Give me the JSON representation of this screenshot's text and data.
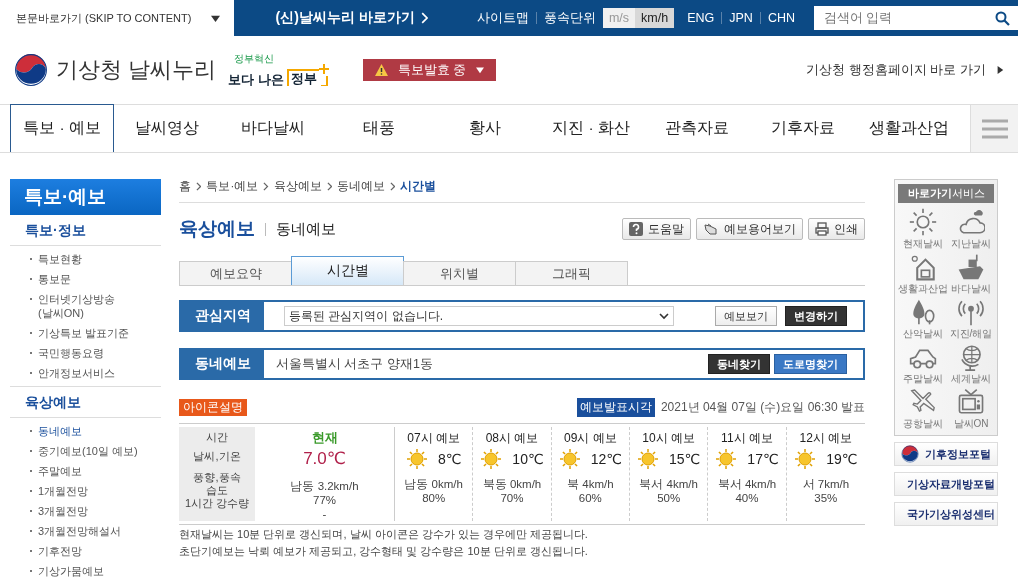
{
  "top_bar": {
    "skip_link": "본문바로가기 (SKIP TO CONTENT)",
    "new_site_link": "(신)날씨누리 바로가기",
    "sitemap": "사이트맵",
    "wind_unit": {
      "label": "풍속단위",
      "options": [
        {
          "label": "m/s",
          "selected": false
        },
        {
          "label": "km/h",
          "selected": true
        }
      ]
    },
    "languages": [
      "ENG",
      "JPN",
      "CHN"
    ],
    "search": {
      "placeholder": "검색어 입력"
    }
  },
  "header": {
    "logo_text": "기상청 날씨누리",
    "gov_badge": {
      "small": "정부혁신",
      "main_left": "보다 나은",
      "main_right": "정부"
    },
    "alert_button": "특보발효 중",
    "admin_link": "기상청 행정홈페이지 바로 가기"
  },
  "nav": [
    {
      "label": "특보 · 예보",
      "selected": true
    },
    {
      "label": "날씨영상",
      "selected": false
    },
    {
      "label": "바다날씨",
      "selected": false
    },
    {
      "label": "태풍",
      "selected": false
    },
    {
      "label": "황사",
      "selected": false
    },
    {
      "label": "지진 · 화산",
      "selected": false
    },
    {
      "label": "관측자료",
      "selected": false
    },
    {
      "label": "기후자료",
      "selected": false
    },
    {
      "label": "생활과산업",
      "selected": false
    }
  ],
  "sidebar": {
    "title": "특보·예보",
    "sections": [
      {
        "title": "특보·정보",
        "items": [
          {
            "label": "특보현황",
            "selected": false
          },
          {
            "label": "통보문",
            "selected": false
          },
          {
            "label": "인터넷기상방송 (날씨ON)",
            "selected": false
          },
          {
            "label": "기상특보 발표기준",
            "selected": false
          },
          {
            "label": "국민행동요령",
            "selected": false
          },
          {
            "label": "안개정보서비스",
            "selected": false
          }
        ]
      },
      {
        "title": "육상예보",
        "items": [
          {
            "label": "동네예보",
            "selected": true
          },
          {
            "label": "중기예보(10일 예보)",
            "selected": false
          },
          {
            "label": "주말예보",
            "selected": false
          },
          {
            "label": "1개월전망",
            "selected": false
          },
          {
            "label": "3개월전망",
            "selected": false
          },
          {
            "label": "3개월전망해설서",
            "selected": false
          },
          {
            "label": "기후전망",
            "selected": false
          },
          {
            "label": "기상가뭄예보",
            "selected": false
          }
        ]
      }
    ]
  },
  "breadcrumb": [
    {
      "label": "홈",
      "selected": false
    },
    {
      "label": "특보·예보",
      "selected": false
    },
    {
      "label": "육상예보",
      "selected": false
    },
    {
      "label": "동네예보",
      "selected": false
    },
    {
      "label": "시간별",
      "selected": true
    }
  ],
  "page_title": "육상예보",
  "page_subtitle": "동네예보",
  "tools": [
    "도움말",
    "예보용어보기",
    "인쇄"
  ],
  "tabs": [
    {
      "label": "예보요약",
      "selected": false
    },
    {
      "label": "시간별",
      "selected": true
    },
    {
      "label": "위치별",
      "selected": false
    },
    {
      "label": "그래픽",
      "selected": false
    }
  ],
  "interest_area": {
    "label": "관심지역",
    "select_value": "등록된 관심지역이 없습니다.",
    "buttons": [
      {
        "label": "예보보기",
        "kind": "light"
      },
      {
        "label": "변경하기",
        "kind": "dark"
      }
    ]
  },
  "local_forecast": {
    "label": "동네예보",
    "location": "서울특별시 서초구 양재1동",
    "buttons": [
      {
        "label": "동네찾기",
        "kind": "dark"
      },
      {
        "label": "도로명찾기",
        "kind": "blue"
      }
    ]
  },
  "icon_legend_button": "아이콘설명",
  "issued": {
    "label": "예보발표시각",
    "value": "2021년 04월 07일 (수)요일 06:30 발표"
  },
  "forecast_table": {
    "row_labels": [
      "시간",
      "날씨,기온",
      "풍향,풍속",
      "습도",
      "1시간 강수량"
    ],
    "current": {
      "label": "현재",
      "temp": "7.0℃",
      "wind": "남동 3.2km/h",
      "humidity": "77%",
      "rain": "-"
    },
    "hours": [
      {
        "label": "07시 예보",
        "temp": "8℃",
        "wind": "남동 0km/h",
        "humidity": "80%"
      },
      {
        "label": "08시 예보",
        "temp": "10℃",
        "wind": "북동 0km/h",
        "humidity": "70%"
      },
      {
        "label": "09시 예보",
        "temp": "12℃",
        "wind": "북 4km/h",
        "humidity": "60%"
      },
      {
        "label": "10시 예보",
        "temp": "15℃",
        "wind": "북서 4km/h",
        "humidity": "50%"
      },
      {
        "label": "11시 예보",
        "temp": "17℃",
        "wind": "북서 4km/h",
        "humidity": "40%"
      },
      {
        "label": "12시 예보",
        "temp": "19℃",
        "wind": "서 7km/h",
        "humidity": "35%"
      }
    ]
  },
  "notes": [
    "현재날씨는 10분 단위로 갱신되며, 날씨 아이콘은 강수가 있는 경우에만 제공됩니다.",
    "초단기예보는 낙뢰 예보가 제공되고, 강수형태 및 강수량은 10분 단위로 갱신됩니다."
  ],
  "quick_services": {
    "title": "**바로가기**서비스",
    "items": [
      "현재날씨",
      "지난날씨",
      "생활과산업",
      "바다날씨",
      "산악날씨",
      "지진/해일",
      "주말날씨",
      "세계날씨",
      "공항날씨",
      "날씨ON"
    ]
  },
  "portal_links": [
    "기후정보포털",
    "기상자료개방포털",
    "국가기상위성센터"
  ]
}
